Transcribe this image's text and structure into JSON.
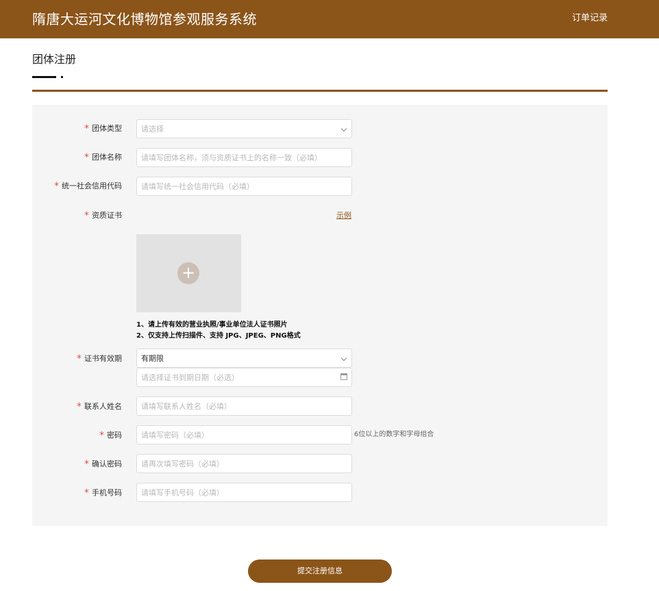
{
  "header": {
    "title": "隋唐大运河文化博物馆参观服务系统",
    "order_link": "订单记录"
  },
  "page": {
    "title": "团体注册"
  },
  "form": {
    "required_mark": "*",
    "group_type": {
      "label": "团体类型",
      "placeholder": "请选择"
    },
    "group_name": {
      "label": "团体名称",
      "placeholder": "请填写团体名称，须与资质证书上的名称一致（必填）"
    },
    "credit_code": {
      "label": "统一社会信用代码",
      "placeholder": "请填写统一社会信用代码（必填）"
    },
    "certificate": {
      "label": "资质证书",
      "example_link": "示例",
      "upload_symbol": "+",
      "note_1": "1、请上传有效的营业执照/事业单位法人证书照片",
      "note_2": "2、仅支持上传扫描件、支持 JPG、JPEG、PNG格式"
    },
    "validity": {
      "label": "证书有效期",
      "selected": "有期限",
      "date_placeholder": "请选择证书到期日期（必选）"
    },
    "contact_name": {
      "label": "联系人姓名",
      "placeholder": "请填写联系人姓名（必填）"
    },
    "password": {
      "label": "密码",
      "placeholder": "请填写密码（必填）",
      "hint": "6位以上的数字和字母组合"
    },
    "confirm_password": {
      "label": "确认密码",
      "placeholder": "请再次填写密码（必填）"
    },
    "phone": {
      "label": "手机号码",
      "placeholder": "请填写手机号码（必填）"
    }
  },
  "submit_label": "提交注册信息",
  "colors": {
    "brand": "#8b5419",
    "required": "#d9534f",
    "panel_bg": "#f5f5f5"
  }
}
